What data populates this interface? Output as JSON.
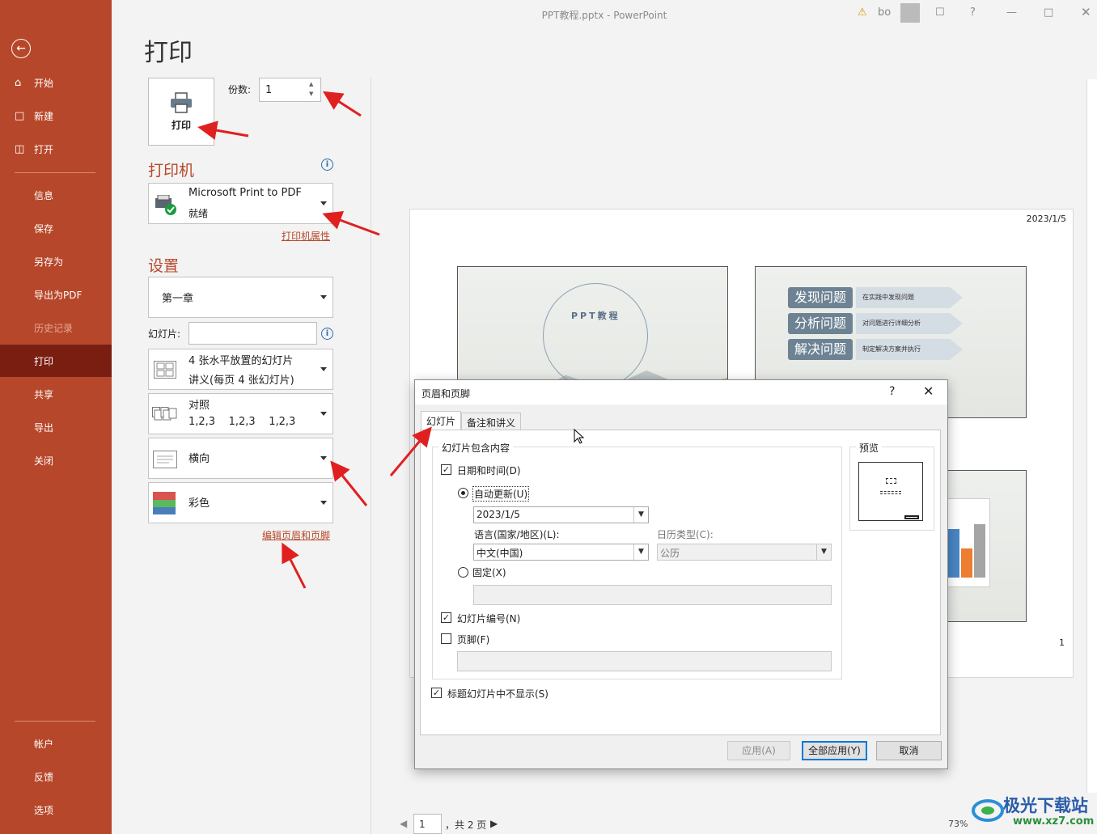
{
  "window": {
    "title": "PPT教程.pptx  -  PowerPoint",
    "user": "bo",
    "help": "?"
  },
  "sidebar": {
    "items": [
      {
        "label": "开始",
        "icon": "home-icon"
      },
      {
        "label": "新建",
        "icon": "new-file-icon"
      },
      {
        "label": "打开",
        "icon": "folder-open-icon"
      },
      {
        "label": "信息"
      },
      {
        "label": "保存"
      },
      {
        "label": "另存为"
      },
      {
        "label": "导出为PDF"
      },
      {
        "label": "历史记录"
      },
      {
        "label": "打印"
      },
      {
        "label": "共享"
      },
      {
        "label": "导出"
      },
      {
        "label": "关闭"
      },
      {
        "label": "帐户"
      },
      {
        "label": "反馈"
      },
      {
        "label": "选项"
      }
    ]
  },
  "print": {
    "heading": "打印",
    "button_label": "打印",
    "copies_label": "份数:",
    "copies_value": "1"
  },
  "printer": {
    "section_title": "打印机",
    "name": "Microsoft Print to PDF",
    "status": "就绪",
    "properties_link": "打印机属性"
  },
  "settings": {
    "section_title": "设置",
    "range": "第一章",
    "slides_label": "幻灯片:",
    "slides_value": "",
    "layout_line1": "4 张水平放置的幻灯片",
    "layout_line2": "讲义(每页 4 张幻灯片)",
    "collate_line1": "对照",
    "collate_line2": "1,2,3    1,2,3    1,2,3",
    "orientation": "横向",
    "color": "彩色",
    "edit_header_footer_link": "编辑页眉和页脚"
  },
  "preview": {
    "date": "2023/1/5",
    "page_number": "1",
    "slide1_title": "PPT教程",
    "pills": [
      {
        "label": "发现问题",
        "desc": "在实践中发现问题"
      },
      {
        "label": "分析问题",
        "desc": "对问题进行详细分析"
      },
      {
        "label": "解决问题",
        "desc": "制定解决方案并执行"
      }
    ],
    "nav_current": "1",
    "nav_total": "，共 2 页",
    "zoom": "73%"
  },
  "dialog": {
    "title": "页眉和页脚",
    "help": "?",
    "tabs": [
      "幻灯片",
      "备注和讲义"
    ],
    "group_label": "幻灯片包含内容",
    "date_time_label": "日期和时间(D)",
    "auto_update_label": "自动更新(U)",
    "auto_date_value": "2023/1/5",
    "language_label": "语言(国家/地区)(L):",
    "language_value": "中文(中国)",
    "calendar_label": "日历类型(C):",
    "calendar_value": "公历",
    "fixed_label": "固定(X)",
    "slide_number_label": "幻灯片编号(N)",
    "footer_label": "页脚(F)",
    "hide_on_title_label": "标题幻灯片中不显示(S)",
    "preview_label": "预览",
    "apply_button": "应用(A)",
    "apply_all_button": "全部应用(Y)",
    "cancel_button": "取消"
  },
  "watermark": {
    "text": "极光下载站",
    "url": "www.xz7.com"
  }
}
